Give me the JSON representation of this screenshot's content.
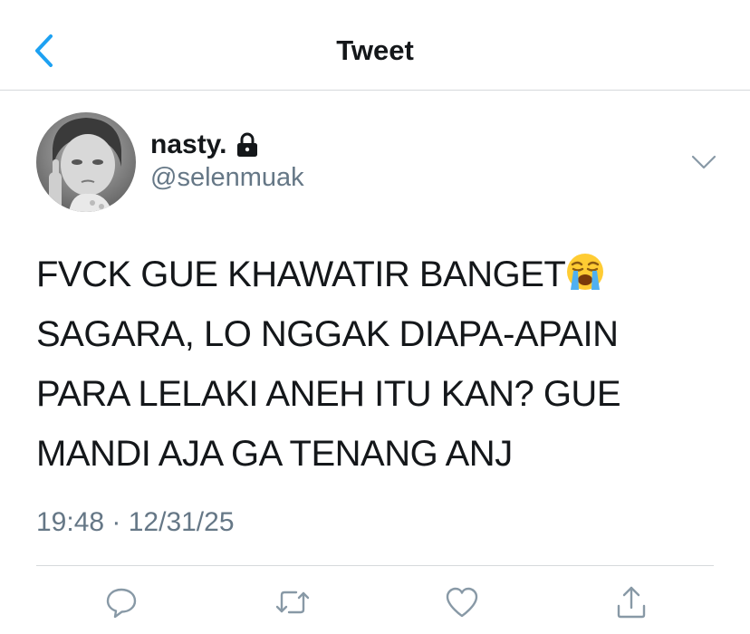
{
  "header": {
    "title": "Tweet",
    "back_icon": "chevron-left-icon",
    "accent_color": "#1da1f2"
  },
  "tweet": {
    "author": {
      "display_name": "nasty.",
      "handle": "@selenmuak",
      "protected_icon": "lock-icon"
    },
    "text_line1": "FVCK GUE KHAWATIR BANGET",
    "emoji": "loudly-crying-face",
    "text_rest": "SAGARA, LO NGGAK DIAPA-APAIN\nPARA LELAKI ANEH ITU KAN? GUE\nMANDI AJA GA TENANG ANJ",
    "timestamp": "19:48 · 12/31/25"
  },
  "actions": [
    {
      "name": "reply-icon"
    },
    {
      "name": "retweet-icon"
    },
    {
      "name": "like-icon"
    },
    {
      "name": "share-icon"
    }
  ],
  "colors": {
    "text": "#14171a",
    "secondary": "#657786",
    "divider": "#d6d9dc"
  }
}
